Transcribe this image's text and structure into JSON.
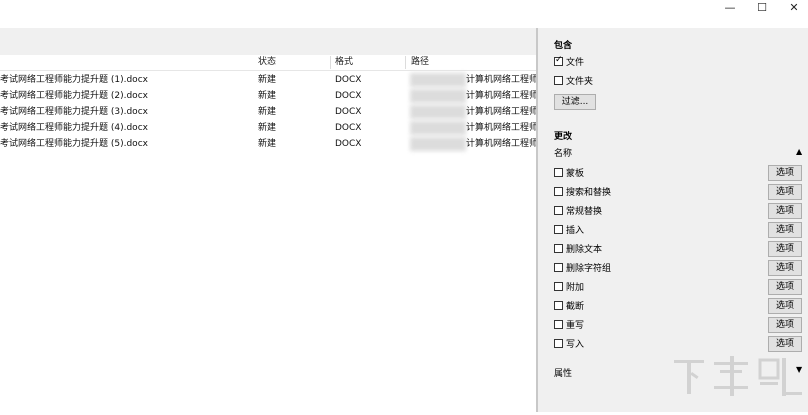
{
  "window": {
    "minimize_icon": "—",
    "maximize_icon": "☐",
    "close_icon": "✕"
  },
  "table": {
    "columns": [
      "状态",
      "格式",
      "路径"
    ],
    "rows": [
      {
        "name": "考试网络工程师能力提升题 (1).docx",
        "status": "新建",
        "format": "DOCX",
        "path": "计算机网络工程师"
      },
      {
        "name": "考试网络工程师能力提升题 (2).docx",
        "status": "新建",
        "format": "DOCX",
        "path": "计算机网络工程师"
      },
      {
        "name": "考试网络工程师能力提升题 (3).docx",
        "status": "新建",
        "format": "DOCX",
        "path": "计算机网络工程师"
      },
      {
        "name": "考试网络工程师能力提升题 (4).docx",
        "status": "新建",
        "format": "DOCX",
        "path": "计算机网络工程师"
      },
      {
        "name": "考试网络工程师能力提升题 (5).docx",
        "status": "新建",
        "format": "DOCX",
        "path": "计算机网络工程师"
      }
    ]
  },
  "include": {
    "title": "包含",
    "file_label": "文件",
    "file_checked": true,
    "folder_label": "文件夹",
    "folder_checked": false,
    "filter_button": "过滤..."
  },
  "changes": {
    "title": "更改",
    "name_header": "名称",
    "collapse_icon": "▲",
    "options_label": "选项",
    "items": [
      {
        "label": "蒙板",
        "checked": false
      },
      {
        "label": "搜索和替换",
        "checked": false
      },
      {
        "label": "常规替换",
        "checked": false
      },
      {
        "label": "插入",
        "checked": false
      },
      {
        "label": "删除文本",
        "checked": false
      },
      {
        "label": "删除字符组",
        "checked": false
      },
      {
        "label": "附加",
        "checked": false
      },
      {
        "label": "截断",
        "checked": false
      },
      {
        "label": "重写",
        "checked": false
      },
      {
        "label": "写入",
        "checked": false
      }
    ]
  },
  "properties": {
    "title": "属性",
    "expand_icon": "▼"
  },
  "watermark": {
    "text": "下载吧",
    "url": "www.xiazaiba.com"
  }
}
